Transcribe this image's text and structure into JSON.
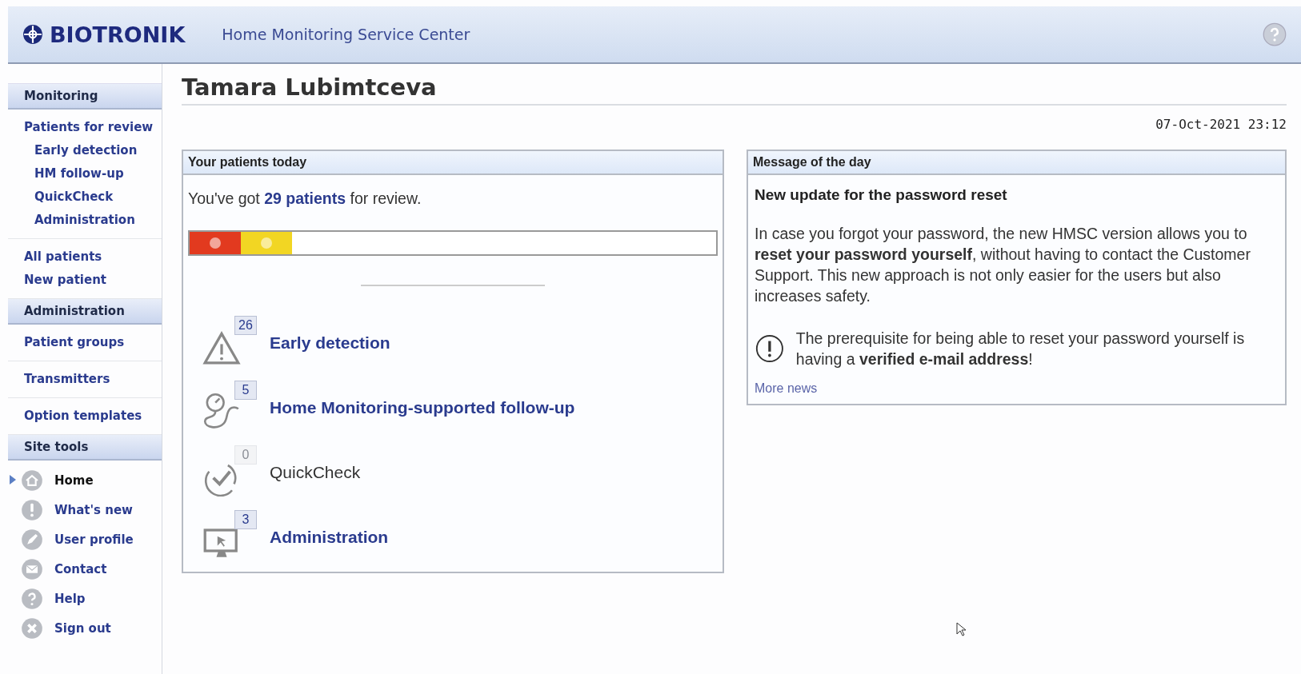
{
  "header": {
    "brand": "BIOTRONIK",
    "subtitle": "Home Monitoring Service Center"
  },
  "sidebar": {
    "sections": [
      {
        "title": "Monitoring",
        "kind": "links",
        "groups": [
          {
            "items": [
              {
                "label": "Patients for review",
                "children": [
                  {
                    "label": "Early detection"
                  },
                  {
                    "label": "HM follow-up"
                  },
                  {
                    "label": "QuickCheck"
                  },
                  {
                    "label": "Administration"
                  }
                ]
              }
            ]
          },
          {
            "items": [
              {
                "label": "All patients"
              },
              {
                "label": "New patient"
              }
            ]
          }
        ]
      },
      {
        "title": "Administration",
        "kind": "links",
        "groups": [
          {
            "items": [
              {
                "label": "Patient groups"
              }
            ]
          },
          {
            "items": [
              {
                "label": "Transmitters"
              }
            ]
          },
          {
            "items": [
              {
                "label": "Option templates"
              }
            ]
          }
        ]
      },
      {
        "title": "Site tools",
        "kind": "tools",
        "items": [
          {
            "label": "Home",
            "kind": "home",
            "selected": true
          },
          {
            "label": "What's new",
            "kind": "exclamation",
            "selected": false
          },
          {
            "label": "User profile",
            "kind": "pen",
            "selected": false
          },
          {
            "label": "Contact",
            "kind": "envelope",
            "selected": false
          },
          {
            "label": "Help",
            "kind": "question",
            "selected": false
          },
          {
            "label": "Sign out",
            "kind": "cross",
            "selected": false
          }
        ]
      }
    ]
  },
  "page": {
    "title": "Tamara Lubimtceva",
    "timestamp": "07-Oct-2021 23:12"
  },
  "patients_panel": {
    "title": "Your patients today",
    "summary_before": "You've got",
    "summary_link": "29 patients",
    "summary_after": "for review.",
    "review_bar": [
      {
        "color": "#e23a1f"
      },
      {
        "color": "#f2d623"
      }
    ],
    "categories": [
      {
        "kind": "warning",
        "count": "26",
        "label": "Early detection",
        "disabled": false
      },
      {
        "kind": "stethoscope",
        "count": "5",
        "label": "Home Monitoring-supported follow-up",
        "disabled": false
      },
      {
        "kind": "quickcheck",
        "count": "0",
        "label": "QuickCheck",
        "disabled": true
      },
      {
        "kind": "monitor",
        "count": "3",
        "label": "Administration",
        "disabled": false
      }
    ]
  },
  "message_panel": {
    "title": "Message of the day",
    "headline": "New update for the password reset",
    "body": "In case you forgot your password, the new HMSC version allows you to **reset your password yourself**, without having to contact the Customer Support. This new approach is not only easier for the users but also increases safety.",
    "notice": "The prerequisite for being able to reset your password yourself is having a **verified e-mail address**!",
    "more_link": "More news"
  }
}
